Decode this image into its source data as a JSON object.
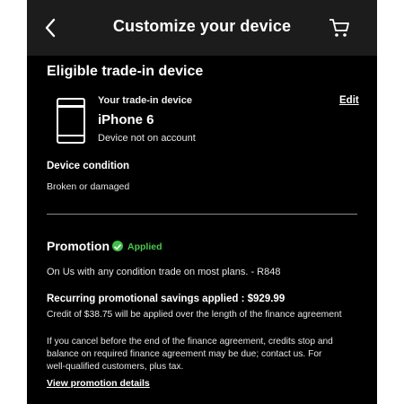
{
  "header": {
    "title": "Customize your device",
    "back_icon": "chevron-left-icon",
    "cart_icon": "cart-icon"
  },
  "tradein": {
    "section_title": "Eligible trade-in device",
    "your_label": "Your trade-in device",
    "device_name": "iPhone 6",
    "account_status": "Device not on account",
    "edit_label": "Edit",
    "condition_label": "Device condition",
    "condition_value": "Broken or damaged"
  },
  "promotion": {
    "title": "Promotion",
    "status": "Applied",
    "status_color": "#3fbf46",
    "offer_text": "On Us with any condition trade on most plans.  -  R848",
    "savings_title": "Recurring promotional savings applied : $929.99",
    "credit_text": "Credit of $38.75 will be applied over the length of the finance agreement",
    "disclaimer_1": "If you cancel before the end of the finance agreement, credits stop and",
    "disclaimer_2": "balance on required finance agreement may be due; contact us. For",
    "disclaimer_3": "well-qualified customers, plus tax.",
    "details_link": "View promotion details"
  }
}
